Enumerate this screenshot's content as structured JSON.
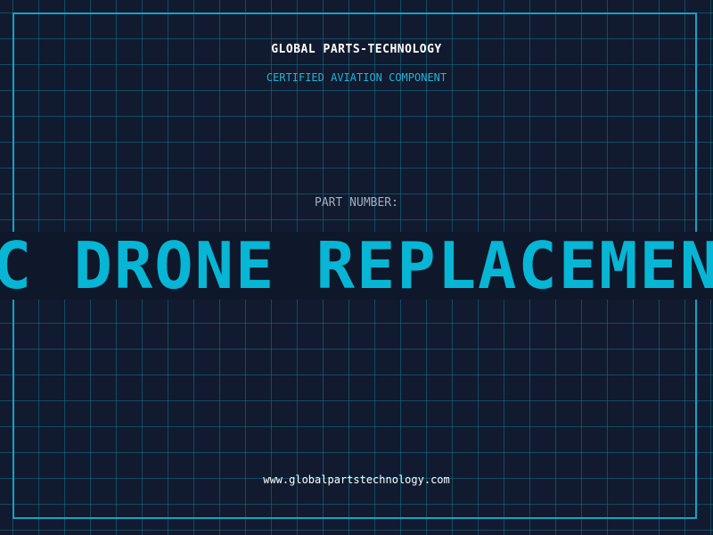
{
  "header": {
    "company": "GLOBAL PARTS-TECHNOLOGY",
    "tagline": "CERTIFIED AVIATION COMPONENT"
  },
  "part": {
    "label": "PART NUMBER:",
    "name": "RC DRONE REPLACEMENT"
  },
  "footer": {
    "website": "www.globalpartstechnology.com"
  },
  "colors": {
    "background": "#111a2e",
    "grid": "#0e7490",
    "frame": "#0ea5c8",
    "accent": "#06b6d4",
    "band": "#0f172a"
  }
}
